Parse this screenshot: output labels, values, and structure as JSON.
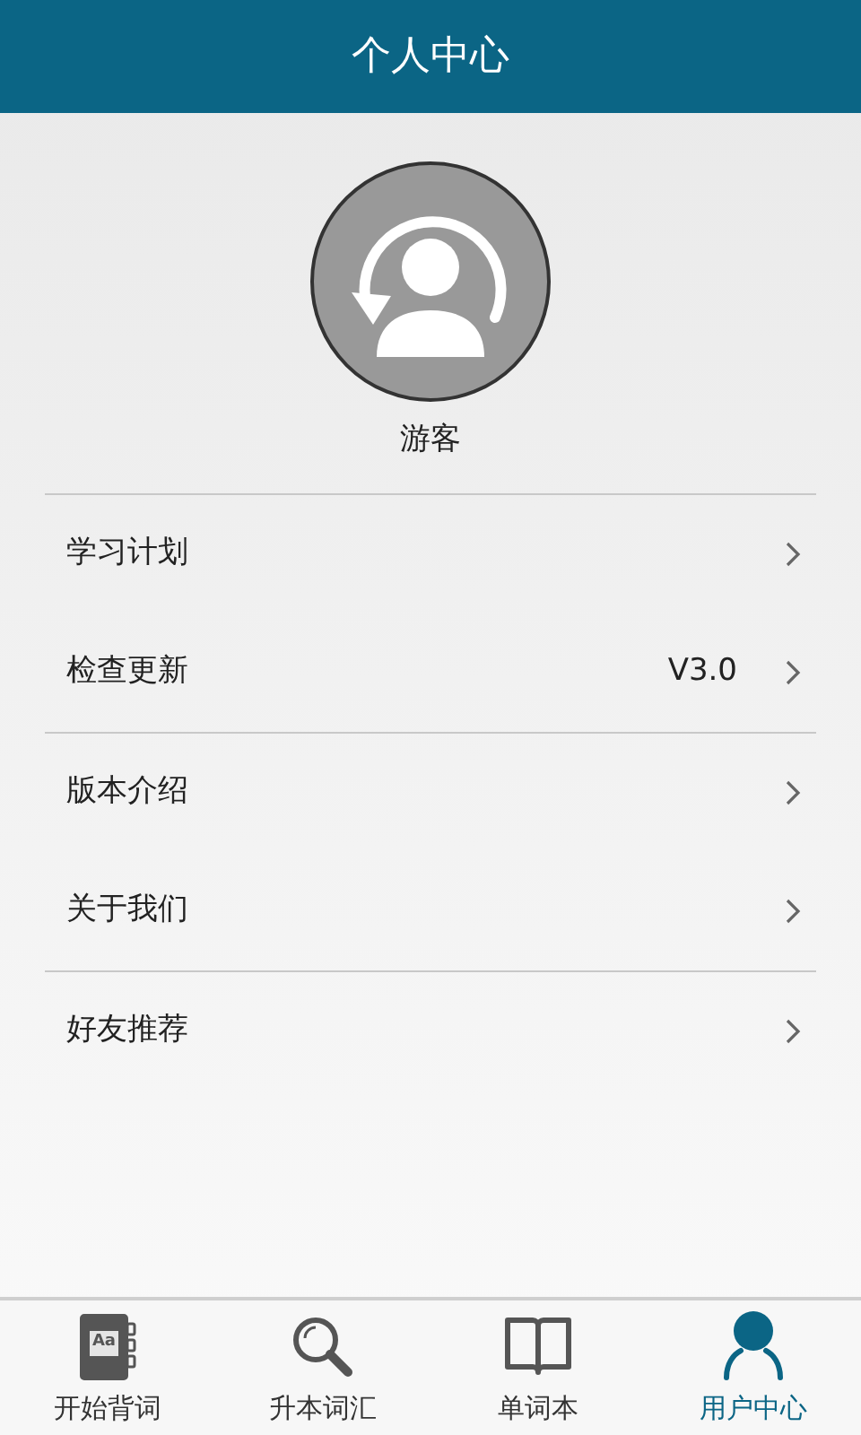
{
  "header": {
    "title": "个人中心"
  },
  "profile": {
    "name": "游客"
  },
  "menu_groups": [
    {
      "items": [
        {
          "label": "学习计划"
        },
        {
          "label": "检查更新",
          "value": "V3.0"
        }
      ]
    },
    {
      "items": [
        {
          "label": "版本介绍"
        },
        {
          "label": "关于我们"
        }
      ]
    },
    {
      "items": [
        {
          "label": "好友推荐"
        }
      ]
    }
  ],
  "tabs": [
    {
      "kind": "dictionary",
      "icon_text": "Aa",
      "label": "开始背词",
      "selected": false
    },
    {
      "kind": "search",
      "label": "升本词汇",
      "selected": false
    },
    {
      "kind": "book",
      "label": "单词本",
      "selected": false
    },
    {
      "kind": "user",
      "label": "用户中心",
      "selected": true
    }
  ]
}
